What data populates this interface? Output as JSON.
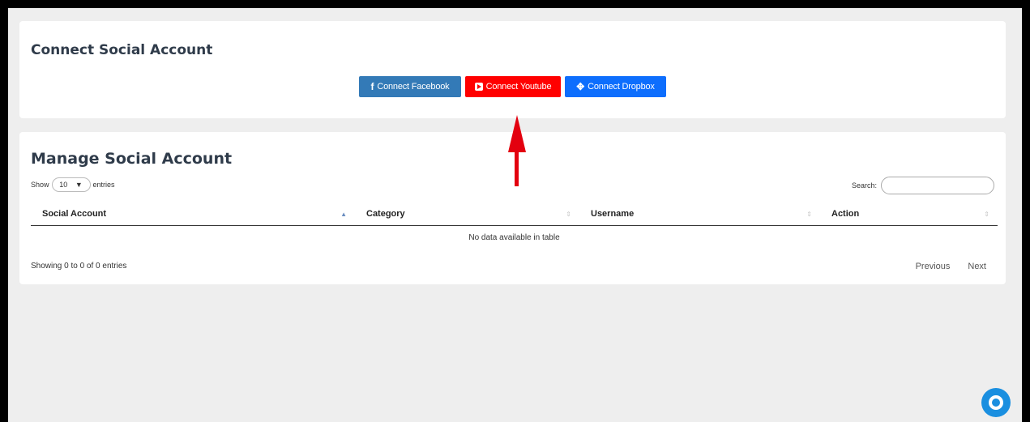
{
  "connect": {
    "title": "Connect Social Account",
    "buttons": {
      "facebook": {
        "icon": "f",
        "label": "Connect Facebook"
      },
      "youtube": {
        "label": "Connect Youtube"
      },
      "dropbox": {
        "icon": "✥",
        "label": "Connect Dropbox"
      }
    }
  },
  "manage": {
    "title": "Manage Social Account",
    "show_label": "Show",
    "page_size": "10",
    "page_size_arrow": "▼",
    "entries_label": "entries",
    "search_label": "Search:",
    "search_value": "",
    "columns": [
      "Social Account",
      "Category",
      "Username",
      "Action"
    ],
    "empty_message": "No data available in table",
    "info": "Showing 0 to 0 of 0 entries",
    "pagination": {
      "previous": "Previous",
      "next": "Next"
    }
  },
  "colors": {
    "facebook": "#337ab7",
    "youtube": "#ff0000",
    "dropbox": "#0d6efd",
    "annotation_arrow": "#e3000f",
    "help_button": "#1a8fe0"
  },
  "icons": {
    "facebook": "facebook-icon",
    "youtube": "youtube-icon",
    "dropbox": "dropbox-icon",
    "help": "lifebuoy-icon"
  }
}
